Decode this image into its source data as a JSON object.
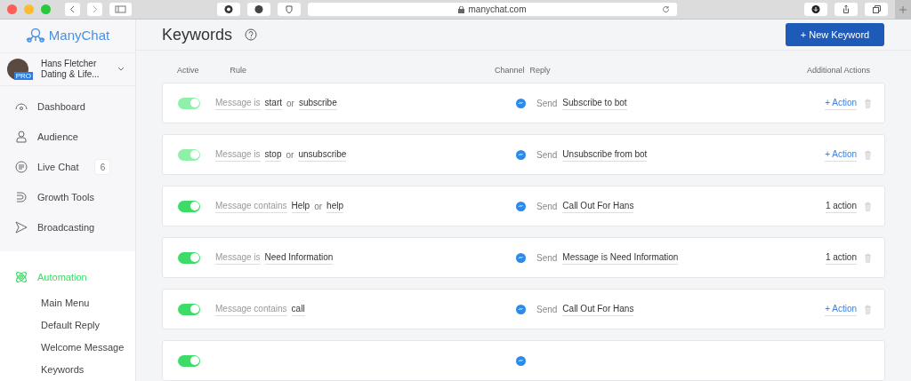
{
  "browser": {
    "url": "manychat.com"
  },
  "sidebar": {
    "logo": "ManyChat",
    "account": {
      "name": "Hans Fletcher",
      "page": "Dating & Life...",
      "badge": "PRO"
    },
    "items": [
      {
        "label": "Dashboard",
        "kind": "dashboard",
        "selected": false
      },
      {
        "label": "Audience",
        "kind": "audience",
        "selected": false
      },
      {
        "label": "Live Chat",
        "kind": "chat",
        "selected": false,
        "count": "6"
      },
      {
        "label": "Growth Tools",
        "kind": "growth",
        "selected": false
      },
      {
        "label": "Broadcasting",
        "kind": "broadcast",
        "selected": false
      },
      {
        "label": "Automation",
        "kind": "automation",
        "selected": true,
        "children": [
          {
            "label": "Main Menu"
          },
          {
            "label": "Default Reply"
          },
          {
            "label": "Welcome Message"
          },
          {
            "label": "Keywords"
          }
        ]
      }
    ]
  },
  "header": {
    "title": "Keywords",
    "new_button": "+ New Keyword"
  },
  "table": {
    "columns": [
      "Active",
      "Rule",
      "Channel",
      "Reply",
      "Additional Actions"
    ],
    "rows": [
      {
        "on": true,
        "disabled": true,
        "condition": "Message is",
        "terms": [
          {
            "kind": "keyword",
            "text": "start"
          },
          {
            "kind": "joiner",
            "text": "or"
          },
          {
            "kind": "keyword",
            "text": "subscribe"
          }
        ],
        "send": "Send",
        "reply": "Subscribe to bot",
        "action": {
          "kind": "add",
          "label": "+ Action"
        }
      },
      {
        "on": true,
        "disabled": true,
        "condition": "Message is",
        "terms": [
          {
            "kind": "keyword",
            "text": "stop"
          },
          {
            "kind": "joiner",
            "text": "or"
          },
          {
            "kind": "keyword",
            "text": "unsubscribe"
          }
        ],
        "send": "Send",
        "reply": "Unsubscribe from bot",
        "action": {
          "kind": "add",
          "label": "+ Action"
        }
      },
      {
        "on": true,
        "disabled": false,
        "condition": "Message contains",
        "terms": [
          {
            "kind": "keyword",
            "text": "Help"
          },
          {
            "kind": "joiner",
            "text": "or"
          },
          {
            "kind": "keyword",
            "text": "help"
          }
        ],
        "send": "Send",
        "reply": "Call Out For Hans",
        "action": {
          "kind": "count",
          "label": "1 action"
        }
      },
      {
        "on": true,
        "disabled": false,
        "condition": "Message is",
        "terms": [
          {
            "kind": "keyword",
            "text": "Need Information"
          }
        ],
        "send": "Send",
        "reply": "Message is Need Information",
        "action": {
          "kind": "count",
          "label": "1 action"
        }
      },
      {
        "on": true,
        "disabled": false,
        "condition": "Message contains",
        "terms": [
          {
            "kind": "keyword",
            "text": "call"
          }
        ],
        "send": "Send",
        "reply": "Call Out For Hans",
        "action": {
          "kind": "add",
          "label": "+ Action"
        }
      },
      {
        "on": true,
        "disabled": false
      }
    ]
  }
}
